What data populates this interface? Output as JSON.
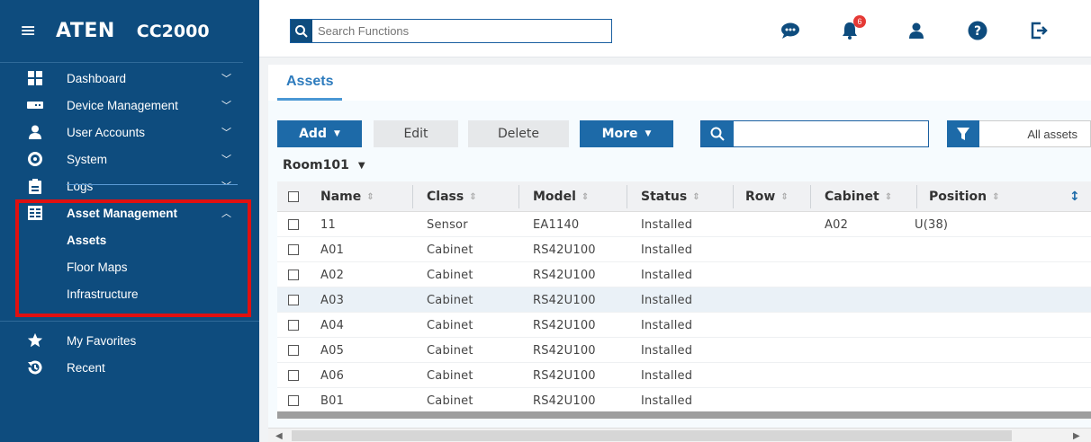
{
  "sidebar": {
    "brand": "ATEN",
    "product": "CC2000",
    "items": [
      {
        "label": "Dashboard",
        "icon": "dashboard-icon"
      },
      {
        "label": "Device Management",
        "icon": "device-icon"
      },
      {
        "label": "User Accounts",
        "icon": "user-icon"
      },
      {
        "label": "System",
        "icon": "gear-icon"
      },
      {
        "label": "Logs",
        "icon": "clipboard-icon"
      },
      {
        "label": "Asset Management",
        "icon": "asset-icon"
      }
    ],
    "subitems": [
      "Assets",
      "Floor Maps",
      "Infrastructure"
    ],
    "extra": [
      {
        "label": "My Favorites",
        "icon": "star-icon"
      },
      {
        "label": "Recent",
        "icon": "history-icon"
      }
    ]
  },
  "topbar": {
    "search_placeholder": "Search Functions",
    "notification_count": "6"
  },
  "main": {
    "tab": "Assets",
    "buttons": {
      "add": "Add",
      "edit": "Edit",
      "delete": "Delete",
      "more": "More"
    },
    "filter_scope": "All assets",
    "room": "Room101",
    "columns": [
      "Name",
      "Class",
      "Model",
      "Status",
      "Row",
      "Cabinet",
      "Position"
    ],
    "rows": [
      {
        "name": "11",
        "class": "Sensor",
        "model": "EA1140",
        "status": "Installed",
        "row": "",
        "cabinet": "A02",
        "position": "U(38)"
      },
      {
        "name": "A01",
        "class": "Cabinet",
        "model": "RS42U100",
        "status": "Installed",
        "row": "",
        "cabinet": "",
        "position": ""
      },
      {
        "name": "A02",
        "class": "Cabinet",
        "model": "RS42U100",
        "status": "Installed",
        "row": "",
        "cabinet": "",
        "position": ""
      },
      {
        "name": "A03",
        "class": "Cabinet",
        "model": "RS42U100",
        "status": "Installed",
        "row": "",
        "cabinet": "",
        "position": ""
      },
      {
        "name": "A04",
        "class": "Cabinet",
        "model": "RS42U100",
        "status": "Installed",
        "row": "",
        "cabinet": "",
        "position": ""
      },
      {
        "name": "A05",
        "class": "Cabinet",
        "model": "RS42U100",
        "status": "Installed",
        "row": "",
        "cabinet": "",
        "position": ""
      },
      {
        "name": "A06",
        "class": "Cabinet",
        "model": "RS42U100",
        "status": "Installed",
        "row": "",
        "cabinet": "",
        "position": ""
      },
      {
        "name": "B01",
        "class": "Cabinet",
        "model": "RS42U100",
        "status": "Installed",
        "row": "",
        "cabinet": "",
        "position": ""
      }
    ]
  },
  "colors": {
    "sidebar": "#0e4c7e",
    "accent": "#1d6aa8",
    "highlight": "#e01010",
    "badge": "#e53935"
  }
}
